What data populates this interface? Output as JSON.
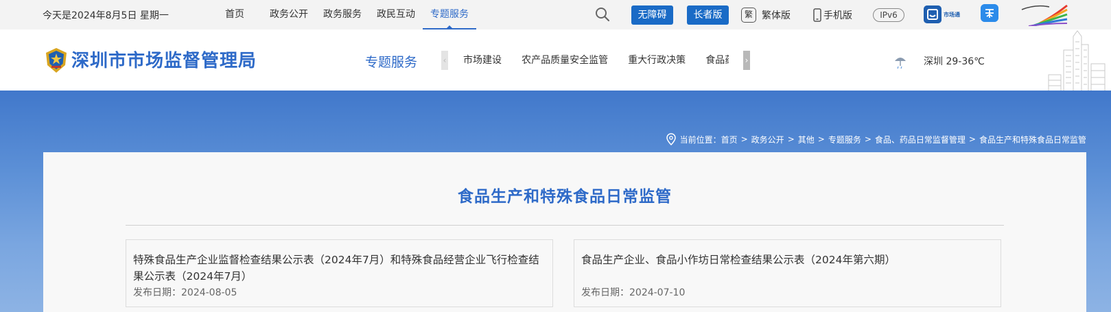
{
  "topbar": {
    "date": "今天是2024年8月5日 星期一",
    "nav": [
      "首页",
      "政务公开",
      "政务服务",
      "政民互动",
      "专题服务"
    ],
    "active_nav": "专题服务",
    "accessibility_label": "无障碍",
    "elder_label": "长者版",
    "traditional_icon_char": "繁",
    "traditional_label": "繁体版",
    "mobile_label": "手机版",
    "ipv6_label": "IPv6",
    "market_app_label": "市场通"
  },
  "header": {
    "site_title": "深圳市市场监督管理局",
    "section_label": "专题服务",
    "subnav": [
      "市场建设",
      "农产品质量安全监管",
      "重大行政决策",
      "食品药"
    ],
    "weather": "深圳  29-36℃"
  },
  "breadcrumb": {
    "prefix": "当前位置：",
    "items": [
      "首页",
      "政务公开",
      "其他",
      "专题服务",
      "食品、药品日常监督管理",
      "食品生产和特殊食品日常监管"
    ],
    "separator": ">"
  },
  "content": {
    "page_title": "食品生产和特殊食品日常监管",
    "articles": [
      {
        "title": "特殊食品生产企业监督检查结果公示表（2024年7月）和特殊食品经营企业飞行检查结果公示表（2024年7月）",
        "date": "发布日期：2024-08-05"
      },
      {
        "title": "食品生产企业、食品小作坊日常检查结果公示表（2024年第六期）",
        "date": "发布日期：2024-07-10"
      }
    ]
  },
  "colors": {
    "brand_blue": "#2e6ac8",
    "button_blue": "#1a6bc6",
    "banner_top": "#4178cb",
    "banner_bottom": "#8db3e4"
  }
}
